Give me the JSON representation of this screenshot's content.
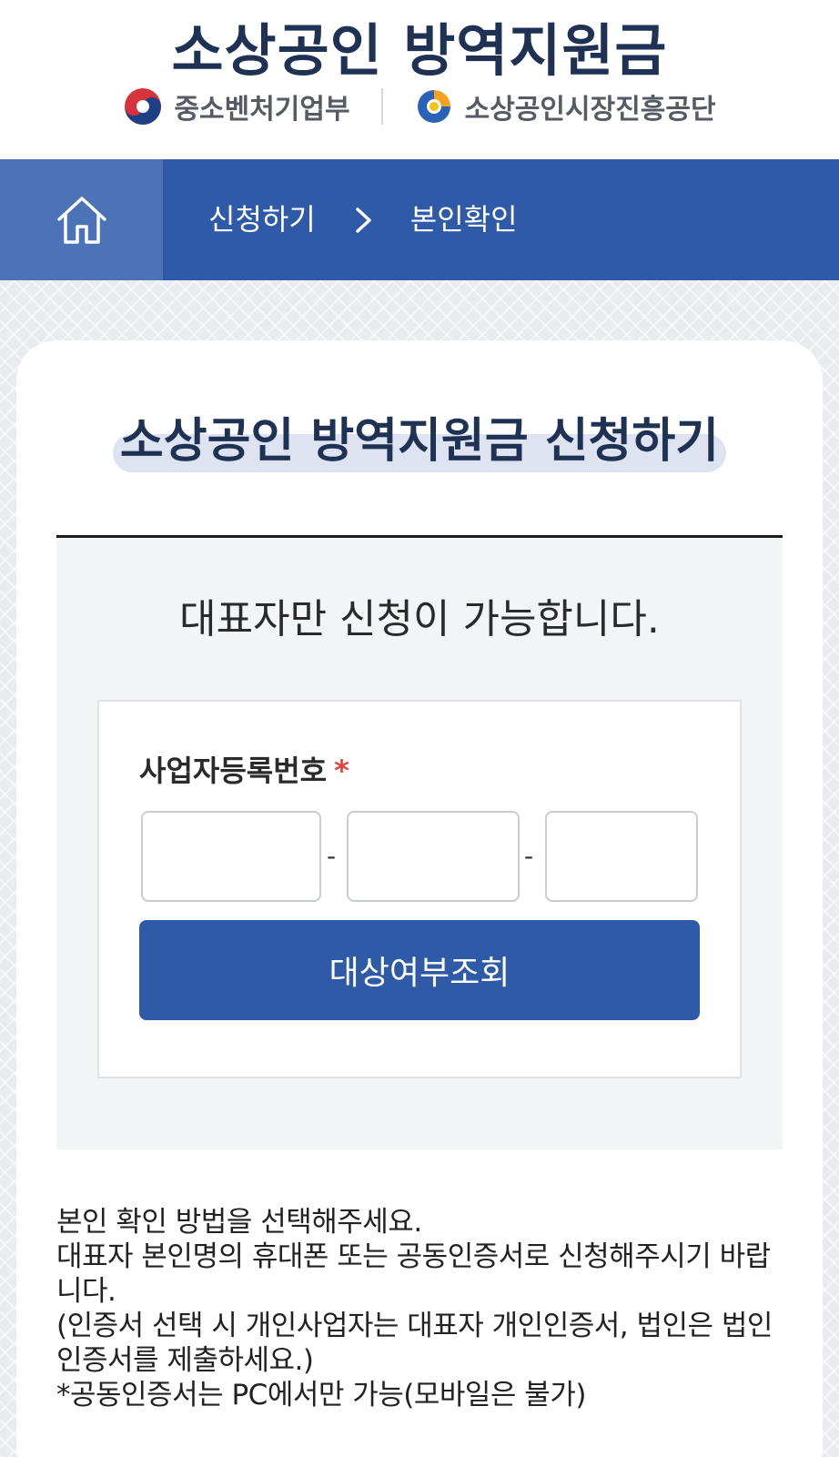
{
  "header": {
    "site_title": "소상공인 방역지원금",
    "org_left": "중소벤처기업부",
    "org_right": "소상공인시장진흥공단"
  },
  "nav": {
    "home_icon": "home-icon",
    "breadcrumb": [
      "신청하기",
      "본인확인"
    ],
    "separator_icon": "chevron-right-icon"
  },
  "card": {
    "title": "소상공인 방역지원금 신청하기",
    "notice": "대표자만 신청이 가능합니다.",
    "form": {
      "label": "사업자등록번호",
      "required_mark": "*",
      "dash": "-",
      "inputs": [
        {
          "value": "",
          "placeholder": ""
        },
        {
          "value": "",
          "placeholder": ""
        },
        {
          "value": "",
          "placeholder": ""
        }
      ],
      "submit_label": "대상여부조회"
    },
    "help_lines": [
      "본인 확인 방법을 선택해주세요.",
      "대표자 본인명의 휴대폰 또는 공동인증서로 신청해주시기 바랍니다.",
      "(인증서 선택 시 개인사업자는 대표자 개인인증서, 법인은 법인인증서를 제출하세요.)",
      "*공동인증서는 PC에서만 가능(모바일은 불가)"
    ]
  },
  "colors": {
    "primary": "#2f5aa8",
    "home_button_bg": "#4c73b8",
    "title_navy": "#1f3254",
    "required_red": "#e0473b"
  }
}
